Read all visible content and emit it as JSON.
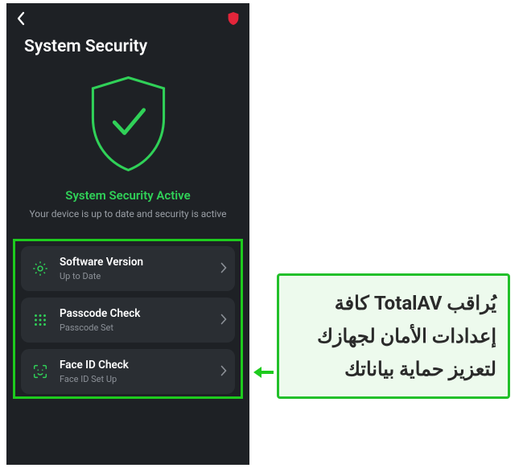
{
  "header": {
    "title": "System Security"
  },
  "status": {
    "title": "System Security Active",
    "subtitle": "Your device is up to date and security is active"
  },
  "cards": [
    {
      "icon": "gear",
      "title": "Software Version",
      "sub": "Up to Date"
    },
    {
      "icon": "keypad",
      "title": "Passcode Check",
      "sub": "Passcode Set"
    },
    {
      "icon": "faceid",
      "title": "Face ID Check",
      "sub": "Face ID Set Up"
    }
  ],
  "callout": {
    "text": "يُراقب TotalAV كافة إعدادات الأمان لجهازك لتعزيز حماية بياناتك"
  },
  "colors": {
    "accent": "#30d158",
    "highlight": "#1ecb1e",
    "logo": "#e3253a"
  }
}
